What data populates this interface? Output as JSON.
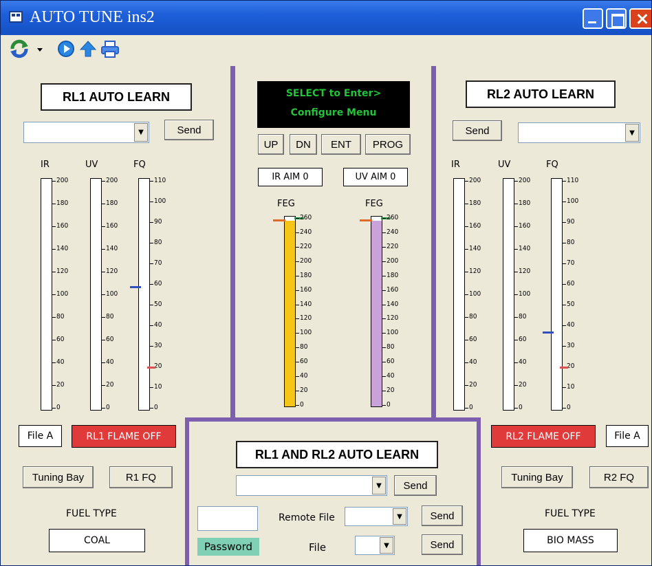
{
  "window": {
    "title": "AUTO TUNE ins2"
  },
  "toolbar": {
    "icons": [
      "refresh-icon",
      "dropdown-caret-icon",
      "play-icon",
      "upload-icon",
      "print-icon"
    ]
  },
  "rl1": {
    "heading": "RL1 AUTO LEARN",
    "send": "Send",
    "gauges": [
      {
        "label": "IR",
        "ticks": [
          "200",
          "180",
          "160",
          "140",
          "120",
          "100",
          "80",
          "60",
          "40",
          "20",
          "0"
        ],
        "marker": null
      },
      {
        "label": "UV",
        "ticks": [
          "200",
          "180",
          "160",
          "140",
          "120",
          "100",
          "80",
          "60",
          "40",
          "20",
          "0"
        ],
        "marker": null
      },
      {
        "label": "FQ",
        "ticks": [
          "110",
          "100",
          "90",
          "80",
          "70",
          "60",
          "50",
          "40",
          "30",
          "20",
          "10",
          "0"
        ],
        "marker_value": 59,
        "marker_color": "#3050c0",
        "limit_value": 20,
        "limit_color": "#e05050"
      }
    ],
    "file": "File A",
    "flame": "RL1 FLAME OFF",
    "tuning_bay": "Tuning Bay",
    "fq_button": "R1 FQ",
    "fuel_type_label": "FUEL TYPE",
    "fuel_type": "COAL"
  },
  "rl2": {
    "heading": "RL2 AUTO LEARN",
    "send": "Send",
    "gauges": [
      {
        "label": "IR",
        "ticks": [
          "200",
          "180",
          "160",
          "140",
          "120",
          "100",
          "80",
          "60",
          "40",
          "20",
          "0"
        ],
        "marker": null
      },
      {
        "label": "UV",
        "ticks": [
          "200",
          "180",
          "160",
          "140",
          "120",
          "100",
          "80",
          "60",
          "40",
          "20",
          "0"
        ],
        "marker": null
      },
      {
        "label": "FQ",
        "ticks": [
          "110",
          "100",
          "90",
          "80",
          "70",
          "60",
          "50",
          "40",
          "30",
          "20",
          "10",
          "0"
        ],
        "marker_value": 37,
        "marker_color": "#3050c0",
        "limit_value": 20,
        "limit_color": "#e05050"
      }
    ],
    "file": "File A",
    "flame": "RL2 FLAME OFF",
    "tuning_bay": "Tuning Bay",
    "fq_button": "R2 FQ",
    "fuel_type_label": "FUEL TYPE",
    "fuel_type": "BIO MASS"
  },
  "center": {
    "lcd_line1": "SELECT to Enter>",
    "lcd_line2": "Configure Menu",
    "nav_buttons": [
      "UP",
      "DN",
      "ENT",
      "PROG"
    ],
    "ir_aim": "IR AIM 0",
    "uv_aim": "UV AIM 0",
    "feg_left": {
      "label": "FEG",
      "ticks": [
        "260",
        "240",
        "220",
        "200",
        "180",
        "160",
        "140",
        "120",
        "100",
        "80",
        "60",
        "40",
        "20",
        "0"
      ],
      "fill_color": "#f5c518",
      "fill_value": 260
    },
    "feg_right": {
      "label": "FEG",
      "ticks": [
        "260",
        "240",
        "220",
        "200",
        "180",
        "160",
        "140",
        "120",
        "100",
        "80",
        "60",
        "40",
        "20",
        "0"
      ],
      "fill_color": "#c8a2d8",
      "fill_value": 260
    }
  },
  "combined": {
    "heading": "RL1 AND RL2 AUTO LEARN",
    "send1": "Send",
    "remote_file_label": "Remote File",
    "send2": "Send",
    "password": "Password",
    "file_label": "File",
    "send3": "Send"
  },
  "colors": {
    "separator": "#7c5fae",
    "flame_red": "#e03a3a",
    "lcd_green": "#22c23a"
  }
}
